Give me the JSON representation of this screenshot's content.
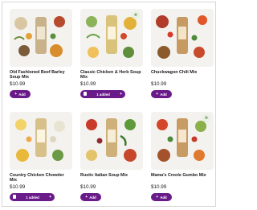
{
  "products": [
    {
      "name": "Old Fashioned Beef Barley Soup Mix",
      "price": "$10.99",
      "action": "add",
      "add_label": "Add",
      "has_leaf_badge": false
    },
    {
      "name": "Classic Chicken & Herb Soup Mix",
      "price": "$10.99",
      "action": "stepper",
      "cart_label": "1 added",
      "has_leaf_badge": true
    },
    {
      "name": "Chuckwagon Chili Mix",
      "price": "$10.99",
      "action": "add",
      "add_label": "Add",
      "has_leaf_badge": false
    },
    {
      "name": "Country Chicken Chowder Mix",
      "price": "$10.99",
      "action": "stepper",
      "cart_label": "1 added",
      "has_leaf_badge": false
    },
    {
      "name": "Rustic Italian Soup Mix",
      "price": "$10.99",
      "action": "add",
      "add_label": "Add",
      "has_leaf_badge": false
    },
    {
      "name": "Mama's Creole Gumbo Mix",
      "price": "$10.99",
      "action": "add",
      "add_label": "Add",
      "has_leaf_badge": true
    }
  ],
  "icons": {
    "add": "plus-icon",
    "remove": "trash-icon",
    "increment": "plus-icon",
    "leaf": "leaf-icon"
  },
  "colors": {
    "accent": "#6a1b8a",
    "background": "#ffffff",
    "thumb_bg": "#f4f2ee"
  }
}
